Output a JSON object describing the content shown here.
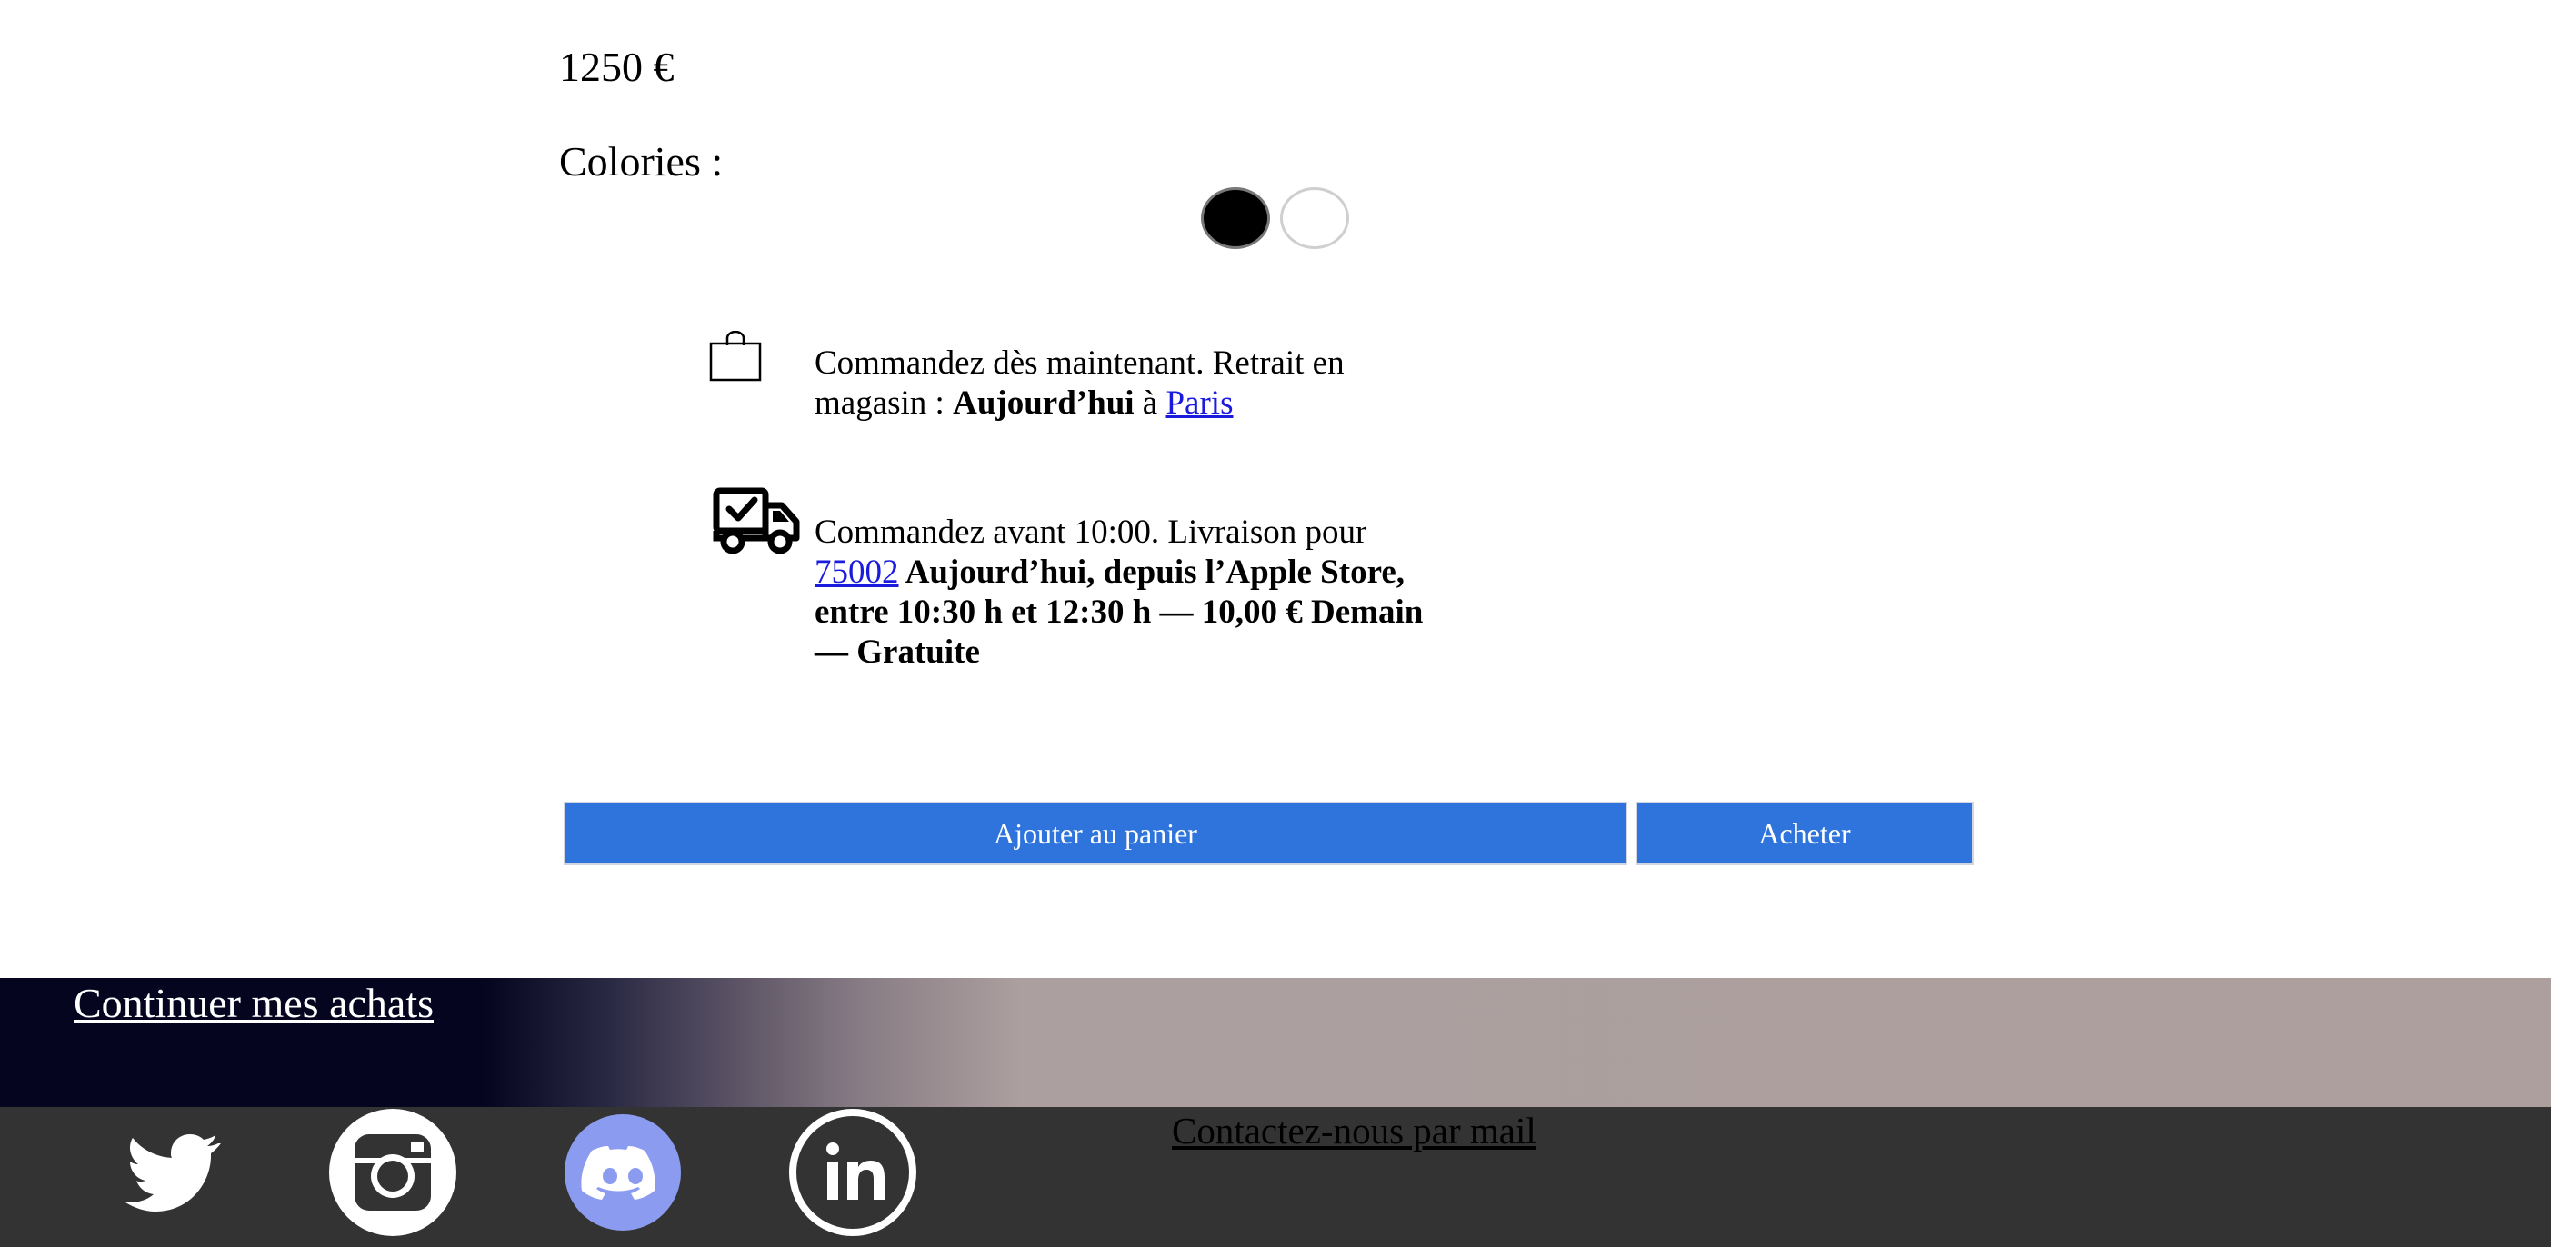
{
  "product": {
    "price": "1250 €",
    "colors_label": "Colories :",
    "colors": [
      {
        "name": "black",
        "hex": "#000000",
        "selected": true
      },
      {
        "name": "white",
        "hex": "#ffffff",
        "selected": false
      }
    ]
  },
  "pickup": {
    "text_prefix": "Commandez dès maintenant. Retrait en magasin : ",
    "bold_day": "Aujourd’hui",
    "connector": " à ",
    "store_link": "Paris"
  },
  "delivery": {
    "text_prefix": "Commandez avant 10:00. Livraison pour ",
    "postcode_link": "75002",
    "bold_details": " Aujourd’hui, depuis l’Apple Store, entre 10:30 h et 12:30 h — 10,00 € Demain — Gratuite"
  },
  "actions": {
    "add_to_cart": "Ajouter au panier",
    "buy": "Acheter"
  },
  "footer": {
    "continue_link": "Continuer mes achats",
    "contact_link": "Contactez-nous par mail",
    "social": [
      "twitter-icon",
      "instagram-icon",
      "discord-icon",
      "linkedin-icon"
    ]
  },
  "colors": {
    "button_blue": "#2e74dc",
    "footer_dark": "#333333",
    "band_dark": "#05051f",
    "band_light": "#ac9f9e",
    "discord_blurple": "#8b9cf0"
  }
}
